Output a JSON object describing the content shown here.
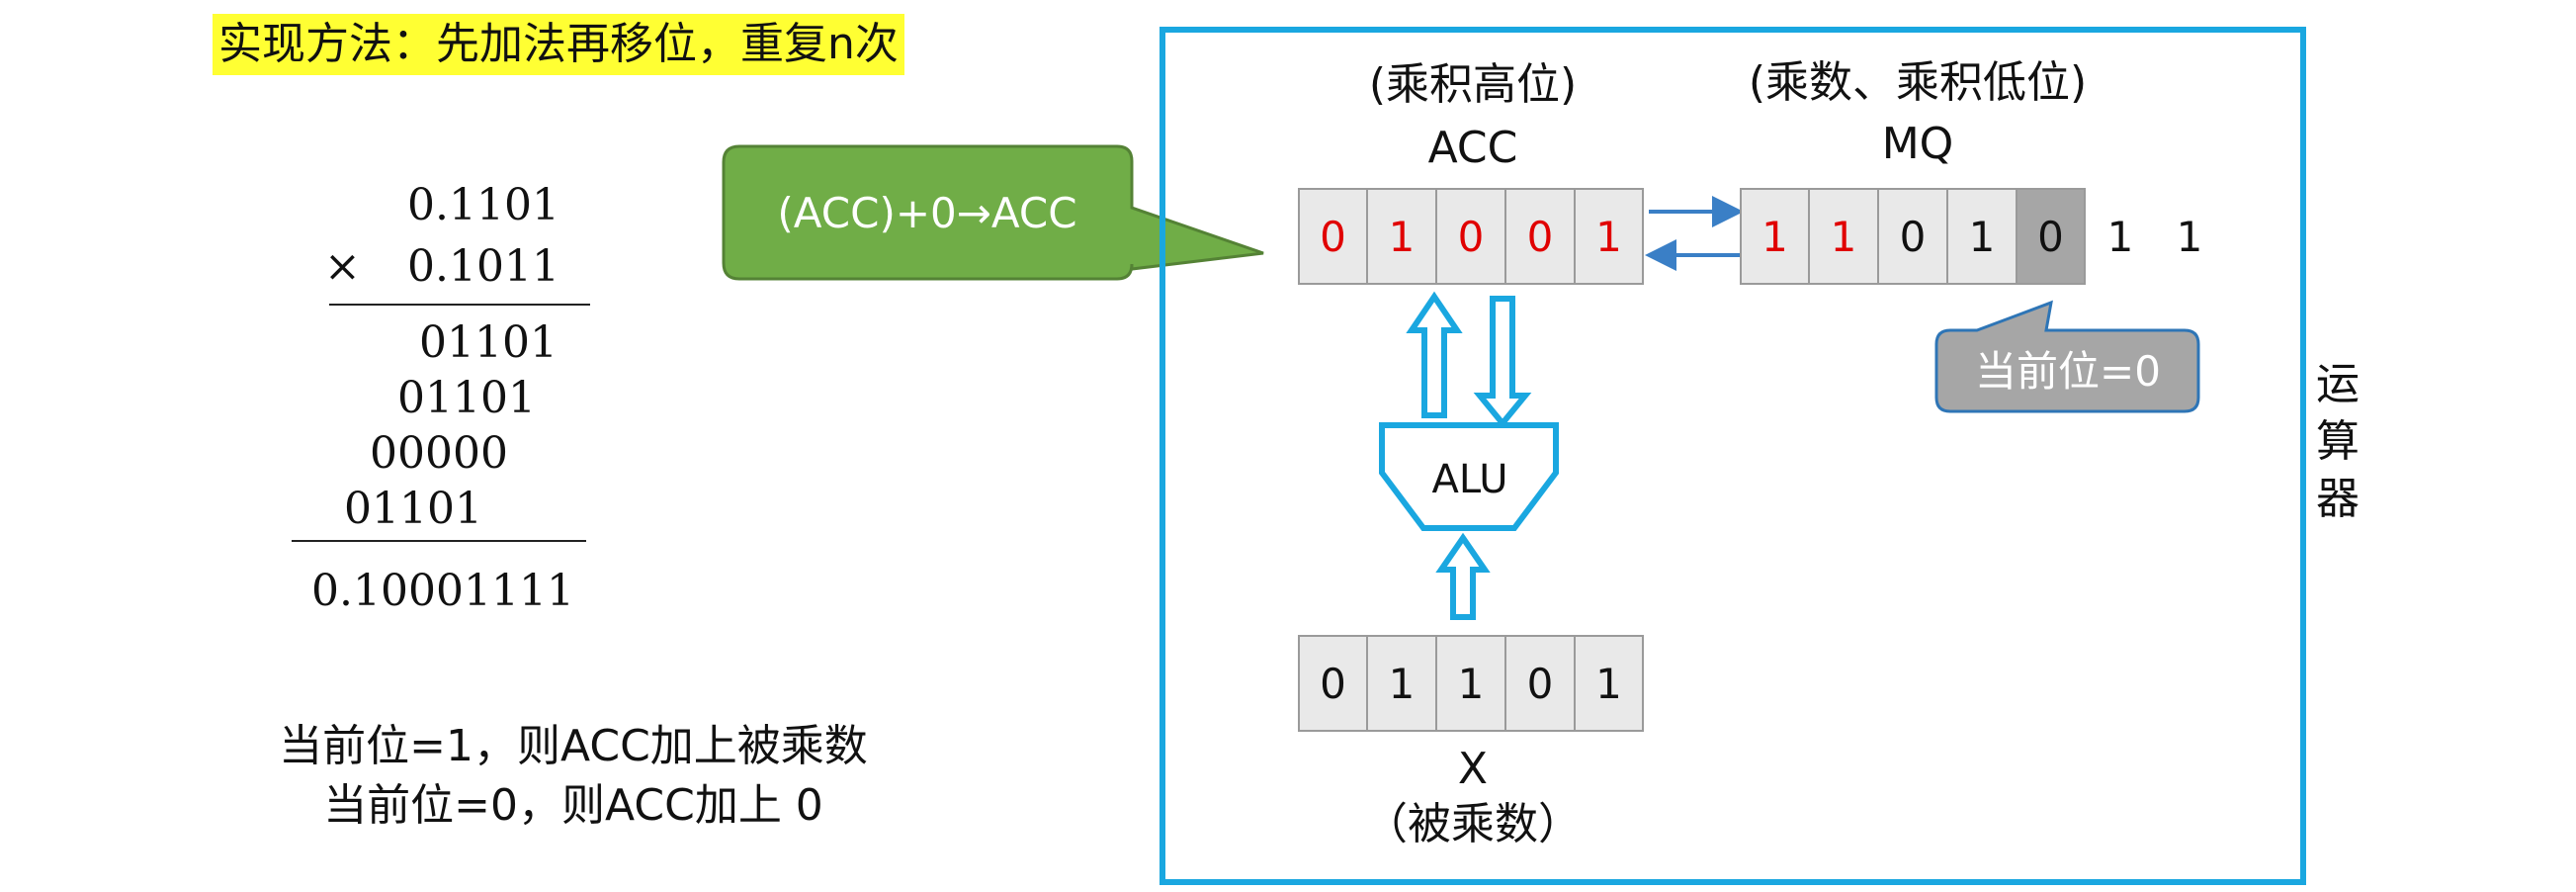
{
  "title": "实现方法：先加法再移位，重复n次",
  "multiplication": {
    "multiplicand": "0.1101",
    "times_sign": "×",
    "multiplier": "0.1011",
    "partial_products": [
      "01101",
      "01101",
      "00000",
      "01101"
    ],
    "result": "0.10001111"
  },
  "rules": [
    "当前位=1，则ACC加上被乘数",
    "当前位=0，则ACC加上 0"
  ],
  "acc": {
    "caption": "(乘积高位)",
    "name": "ACC",
    "bits": [
      "0",
      "1",
      "0",
      "0",
      "1"
    ]
  },
  "mq": {
    "caption": "(乘数、乘积低位)",
    "name": "MQ",
    "bits": [
      "1",
      "1",
      "0",
      "1",
      "0"
    ],
    "shifted_out": [
      "1",
      "1"
    ]
  },
  "x": {
    "name": "X",
    "caption": "（被乘数）",
    "bits": [
      "0",
      "1",
      "1",
      "0",
      "1"
    ]
  },
  "alu_label": "ALU",
  "callout_operation": "(ACC)+0→ACC",
  "callout_current_bit": "当前位=0",
  "unit_label": [
    "运",
    "算",
    "器"
  ],
  "colors": {
    "frame": "#1aa7e0",
    "highlight": "#ffff33",
    "green_callout": "#70ad47",
    "gray_callout": "#a6a6a6",
    "red_bit": "#e00000"
  }
}
